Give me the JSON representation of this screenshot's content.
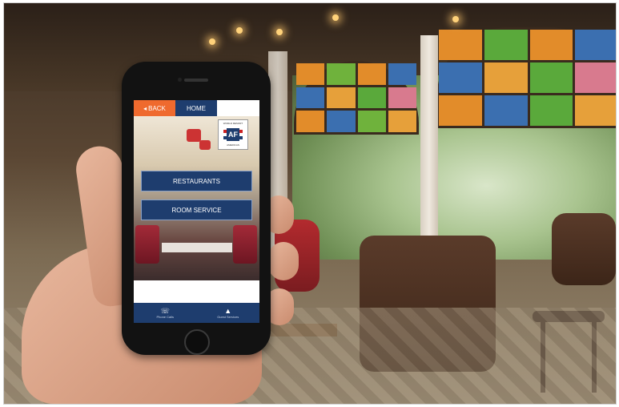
{
  "app": {
    "topbar": {
      "back_label": "BACK",
      "back_icon": "arrow-left-icon",
      "home_label": "HOME"
    },
    "logo": {
      "top_text": "WORLD RESORT",
      "mark_text": "AF",
      "bottom_text": "AMERICAS"
    },
    "menu": [
      {
        "label": "RESTAURANTS"
      },
      {
        "label": "ROOM SERVICE"
      }
    ],
    "bottom_nav": [
      {
        "icon": "telephone-icon",
        "label": "Phone Calls"
      },
      {
        "icon": "service-bell-icon",
        "label": "Guest Services"
      }
    ]
  },
  "colors": {
    "accent_orange": "#ef6a2e",
    "brand_navy": "#1e3d6e"
  }
}
